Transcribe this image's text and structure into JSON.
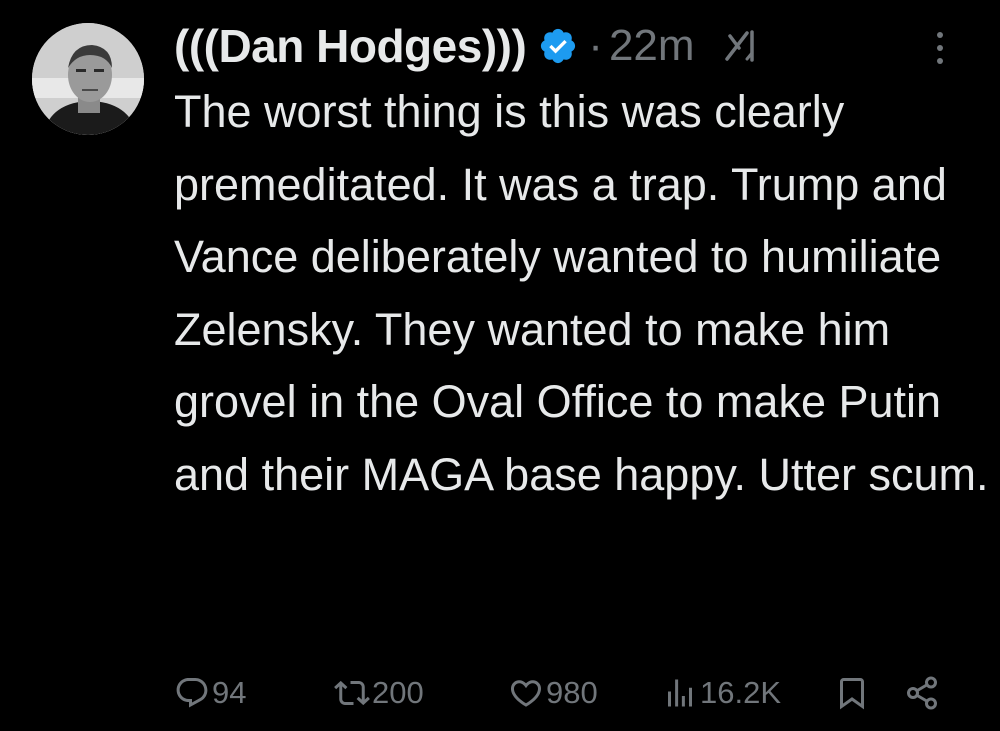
{
  "author": {
    "display_name": "(((Dan Hodges)))",
    "verified": true,
    "verified_color": "#1d9bf0",
    "avatar_icon": "avatar-photo"
  },
  "meta": {
    "separator": "·",
    "timestamp": "22m",
    "grok_icon": "grok-icon",
    "more_icon": "more-vertical-icon"
  },
  "tweet": {
    "text": "The worst thing is this was clearly premeditated. It was a trap. Trump and Vance deliberately wanted to humiliate Zelensky. They wanted to make him grovel in the Oval Office to make Putin and their MAGA base happy. Utter scum."
  },
  "actions": {
    "reply": {
      "icon": "reply-icon",
      "count": "94"
    },
    "repost": {
      "icon": "repost-icon",
      "count": "200"
    },
    "like": {
      "icon": "heart-icon",
      "count": "980"
    },
    "views": {
      "icon": "views-icon",
      "count": "16.2K"
    },
    "bookmark": {
      "icon": "bookmark-icon"
    },
    "share": {
      "icon": "share-icon"
    }
  },
  "colors": {
    "background": "#000000",
    "text_primary": "#e7e9ea",
    "text_secondary": "#71767b"
  }
}
